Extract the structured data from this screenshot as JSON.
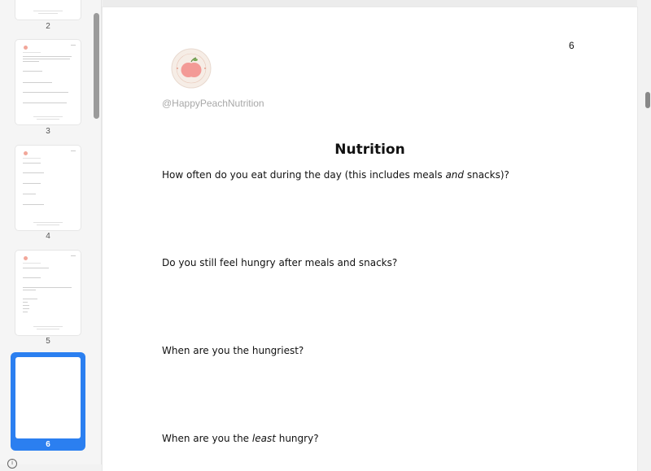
{
  "sidebar": {
    "thumbnails": [
      {
        "number": "2"
      },
      {
        "number": "3"
      },
      {
        "number": "4"
      },
      {
        "number": "5"
      },
      {
        "number": "6",
        "selected": true
      }
    ]
  },
  "document": {
    "page_number": "6",
    "handle": "@HappyPeachNutrition",
    "title": "Nutrition",
    "questions": [
      {
        "before": "How often do you eat during the day (this includes meals ",
        "em": "and",
        "after": " snacks)?"
      },
      {
        "before": "Do you still feel hungry after meals and snacks?",
        "em": "",
        "after": ""
      },
      {
        "before": "When are you the hungriest?",
        "em": "",
        "after": ""
      },
      {
        "before": "When are you the ",
        "em": "least",
        "after": " hungry?"
      }
    ]
  },
  "colors": {
    "selection": "#2b7ff0",
    "peach": "#f2a79a"
  }
}
